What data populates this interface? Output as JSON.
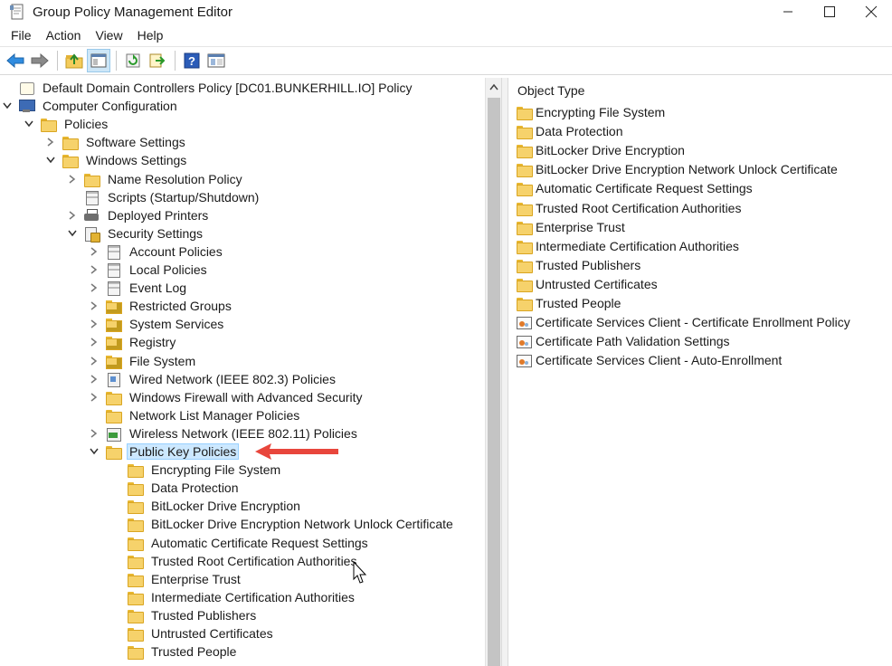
{
  "window": {
    "title": "Group Policy Management Editor",
    "icon": "gpo-editor-icon",
    "controls": [
      "minimize-icon",
      "maximize-icon",
      "close-icon"
    ]
  },
  "menu": [
    "File",
    "Action",
    "View",
    "Help"
  ],
  "toolbar": {
    "buttons": [
      "back-icon",
      "forward-icon",
      "up-folder-icon",
      "show-hide-tree-icon",
      "refresh-icon",
      "export-list-icon",
      "help-icon",
      "properties-icon"
    ]
  },
  "tree": [
    {
      "label": "Default Domain Controllers Policy [DC01.BUNKERHILL.IO] Policy",
      "icon": "scroll-icon",
      "level": 0,
      "expander": ""
    },
    {
      "label": "Computer Configuration",
      "icon": "computer-icon",
      "level": 0,
      "expander": "expanded"
    },
    {
      "label": "Policies",
      "icon": "folder-icon",
      "level": 1,
      "expander": "expanded"
    },
    {
      "label": "Software Settings",
      "icon": "folder-icon",
      "level": 2,
      "expander": "collapsed"
    },
    {
      "label": "Windows Settings",
      "icon": "folder-icon",
      "level": 2,
      "expander": "expanded"
    },
    {
      "label": "Name Resolution Policy",
      "icon": "folder-icon",
      "level": 3,
      "expander": "collapsed"
    },
    {
      "label": "Scripts (Startup/Shutdown)",
      "icon": "document-icon",
      "level": 3,
      "expander": ""
    },
    {
      "label": "Deployed Printers",
      "icon": "printer-icon",
      "level": 3,
      "expander": "collapsed"
    },
    {
      "label": "Security Settings",
      "icon": "security-settings-icon",
      "level": 3,
      "expander": "expanded"
    },
    {
      "label": "Account Policies",
      "icon": "policy-document-icon",
      "level": 4,
      "expander": "collapsed"
    },
    {
      "label": "Local Policies",
      "icon": "policy-document-icon",
      "level": 4,
      "expander": "collapsed"
    },
    {
      "label": "Event Log",
      "icon": "policy-document-icon",
      "level": 4,
      "expander": "collapsed"
    },
    {
      "label": "Restricted Groups",
      "icon": "lock-folder-icon",
      "level": 4,
      "expander": "collapsed"
    },
    {
      "label": "System Services",
      "icon": "lock-folder-icon",
      "level": 4,
      "expander": "collapsed"
    },
    {
      "label": "Registry",
      "icon": "lock-folder-icon",
      "level": 4,
      "expander": "collapsed"
    },
    {
      "label": "File System",
      "icon": "lock-folder-icon",
      "level": 4,
      "expander": "collapsed"
    },
    {
      "label": "Wired Network (IEEE 802.3) Policies",
      "icon": "wired-network-icon",
      "level": 4,
      "expander": "collapsed"
    },
    {
      "label": "Windows Firewall with Advanced Security",
      "icon": "folder-icon",
      "level": 4,
      "expander": "collapsed"
    },
    {
      "label": "Network List Manager Policies",
      "icon": "folder-icon",
      "level": 4,
      "expander": ""
    },
    {
      "label": "Wireless Network (IEEE 802.11) Policies",
      "icon": "wireless-network-icon",
      "level": 4,
      "expander": "collapsed"
    },
    {
      "label": "Public Key Policies",
      "icon": "folder-icon",
      "level": 4,
      "expander": "expanded",
      "selected": true
    },
    {
      "label": "Encrypting File System",
      "icon": "folder-icon",
      "level": 5,
      "expander": ""
    },
    {
      "label": "Data Protection",
      "icon": "folder-icon",
      "level": 5,
      "expander": ""
    },
    {
      "label": "BitLocker Drive Encryption",
      "icon": "folder-icon",
      "level": 5,
      "expander": ""
    },
    {
      "label": "BitLocker Drive Encryption Network Unlock Certificate",
      "icon": "folder-icon",
      "level": 5,
      "expander": ""
    },
    {
      "label": "Automatic Certificate Request Settings",
      "icon": "folder-icon",
      "level": 5,
      "expander": ""
    },
    {
      "label": "Trusted Root Certification Authorities",
      "icon": "folder-icon",
      "level": 5,
      "expander": ""
    },
    {
      "label": "Enterprise Trust",
      "icon": "folder-icon",
      "level": 5,
      "expander": ""
    },
    {
      "label": "Intermediate Certification Authorities",
      "icon": "folder-icon",
      "level": 5,
      "expander": ""
    },
    {
      "label": "Trusted Publishers",
      "icon": "folder-icon",
      "level": 5,
      "expander": ""
    },
    {
      "label": "Untrusted Certificates",
      "icon": "folder-icon",
      "level": 5,
      "expander": ""
    },
    {
      "label": "Trusted People",
      "icon": "folder-icon",
      "level": 5,
      "expander": ""
    }
  ],
  "details": {
    "column_header": "Object Type",
    "items": [
      {
        "label": "Encrypting File System",
        "icon": "folder-icon"
      },
      {
        "label": "Data Protection",
        "icon": "folder-icon"
      },
      {
        "label": "BitLocker Drive Encryption",
        "icon": "folder-icon"
      },
      {
        "label": "BitLocker Drive Encryption Network Unlock Certificate",
        "icon": "folder-icon"
      },
      {
        "label": "Automatic Certificate Request Settings",
        "icon": "folder-icon"
      },
      {
        "label": "Trusted Root Certification Authorities",
        "icon": "folder-icon"
      },
      {
        "label": "Enterprise Trust",
        "icon": "folder-icon"
      },
      {
        "label": "Intermediate Certification Authorities",
        "icon": "folder-icon"
      },
      {
        "label": "Trusted Publishers",
        "icon": "folder-icon"
      },
      {
        "label": "Untrusted Certificates",
        "icon": "folder-icon"
      },
      {
        "label": "Trusted People",
        "icon": "folder-icon"
      },
      {
        "label": "Certificate Services Client - Certificate Enrollment Policy",
        "icon": "certificate-policy-icon"
      },
      {
        "label": "Certificate Path Validation Settings",
        "icon": "certificate-policy-icon"
      },
      {
        "label": "Certificate Services Client - Auto-Enrollment",
        "icon": "certificate-policy-icon"
      }
    ]
  },
  "colors": {
    "selection_bg": "#cce8ff",
    "selection_border": "#99d1ff",
    "annotation_arrow": "#e8463c",
    "folder": "#f6d26b"
  }
}
